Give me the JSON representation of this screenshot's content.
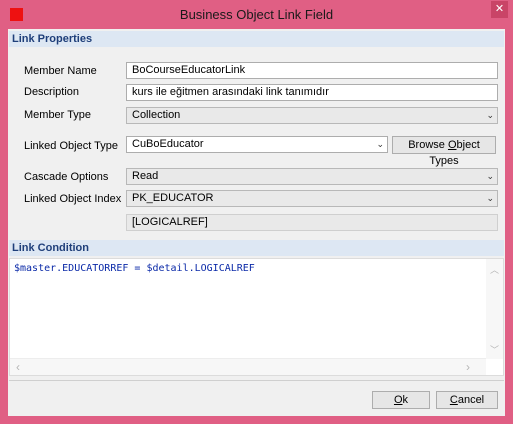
{
  "window": {
    "title": "Business Object Link Field",
    "close_glyph": "✕",
    "title_bar_color": "#e05f84"
  },
  "link_properties": {
    "header": "Link Properties",
    "member_name": {
      "label": "Member Name",
      "value": "BoCourseEducatorLink"
    },
    "description": {
      "label": "Description",
      "value": "kurs ile eğitmen arasındaki link tanımıdır"
    },
    "member_type": {
      "label": "Member Type",
      "value": "Collection"
    },
    "linked_object_type": {
      "label": "Linked Object Type",
      "value": "CuBoEducator"
    },
    "browse_button": {
      "pre": "Browse ",
      "mnemonic": "O",
      "post": "bject Types"
    },
    "cascade_options": {
      "label": "Cascade Options",
      "value": "Read"
    },
    "linked_object_index": {
      "label": "Linked Object Index",
      "value": "PK_EDUCATOR",
      "fields": "[LOGICALREF]"
    }
  },
  "link_condition": {
    "header": "Link Condition",
    "code": "$master.EDUCATORREF = $detail.LOGICALREF"
  },
  "footer": {
    "ok": {
      "mnemonic": "O",
      "rest": "k"
    },
    "cancel": {
      "mnemonic": "C",
      "rest": "ancel"
    }
  },
  "icons": {
    "dropdown_arrow": "⌄",
    "scroll_up": "︿",
    "scroll_down": "﹀",
    "scroll_left": "‹",
    "scroll_right": "›"
  }
}
